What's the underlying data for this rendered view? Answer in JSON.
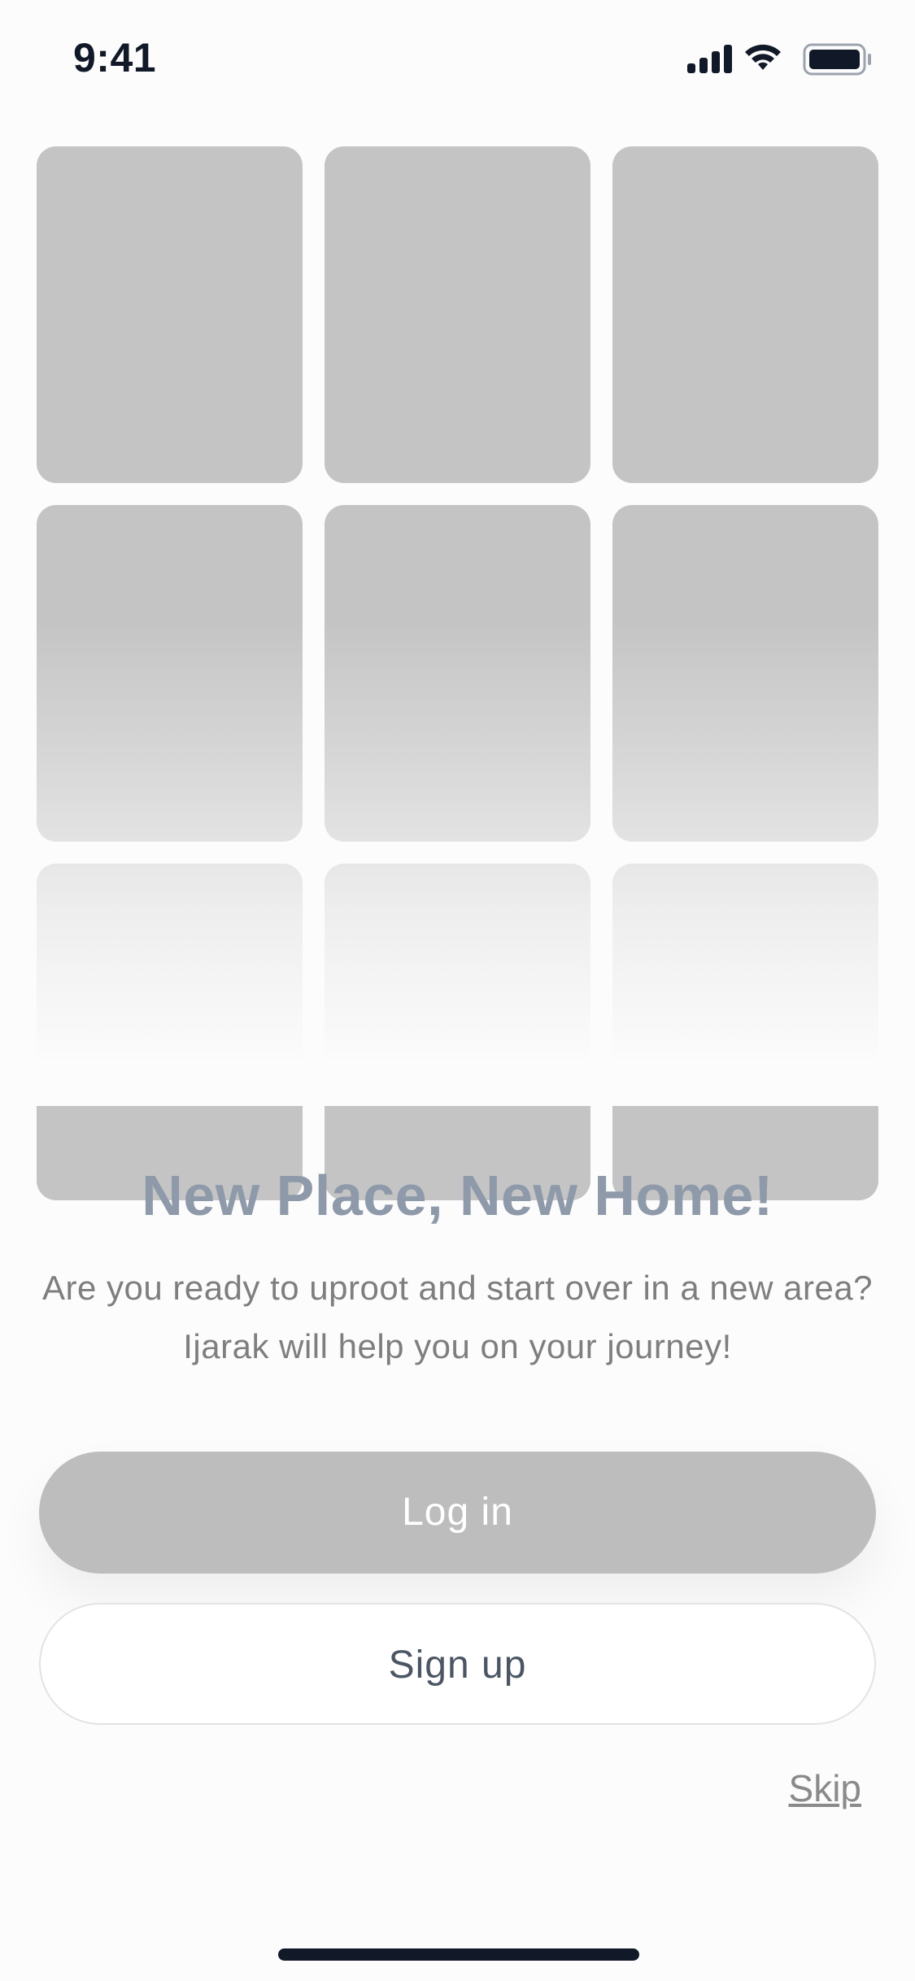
{
  "status_bar": {
    "time": "9:41",
    "icons": [
      "cellular-signal-icon",
      "wifi-icon",
      "battery-icon"
    ]
  },
  "gallery": {
    "placeholder_count": 9,
    "placeholder_color": "#C4C4C4"
  },
  "onboarding": {
    "title": "New Place, New Home!",
    "description": "Are you ready to uproot and start over in a new area? Ijarak will help you on your journey!"
  },
  "actions": {
    "login_label": "Log in",
    "signup_label": "Sign up",
    "skip_label": "Skip"
  },
  "colors": {
    "background": "#FCFCFC",
    "title": "#8E99A9",
    "login_button": "#BDBDBD",
    "signup_text": "#4B5563",
    "home_indicator": "#111827"
  }
}
